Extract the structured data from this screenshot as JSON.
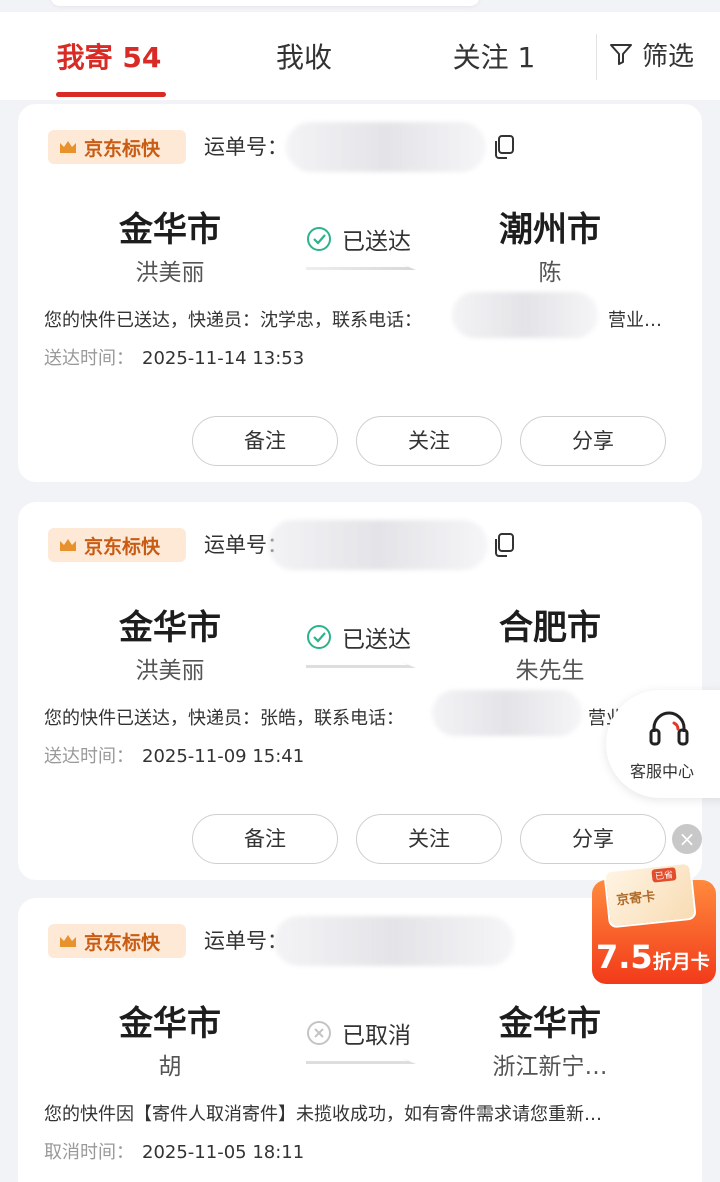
{
  "tabs": [
    {
      "label": "我寄 54",
      "active": true
    },
    {
      "label": "我收",
      "active": false
    },
    {
      "label": "关注 1",
      "active": false
    }
  ],
  "filter_label": "筛选",
  "waybill_label": "运单号：",
  "orders": [
    {
      "brand": "京东标快",
      "from_city": "金华市",
      "from_person": "洪美丽",
      "status": "已送达",
      "status_type": "delivered",
      "to_city": "潮州市",
      "to_person": "陈",
      "description": "您的快件已送达，快递员：沈学忠，联系电话：",
      "description_tail": "营业…",
      "time_label": "送达时间：",
      "time_value": "2025-11-14 13:53",
      "buttons": [
        "备注",
        "关注",
        "分享"
      ]
    },
    {
      "brand": "京东标快",
      "from_city": "金华市",
      "from_person": "洪美丽",
      "status": "已送达",
      "status_type": "delivered",
      "to_city": "合肥市",
      "to_person": "朱先生",
      "description": "您的快件已送达，快递员：张皓，联系电话：",
      "description_tail": "营业",
      "time_label": "送达时间：",
      "time_value": "2025-11-09 15:41",
      "buttons": [
        "备注",
        "关注",
        "分享"
      ]
    },
    {
      "brand": "京东标快",
      "from_city": "金华市",
      "from_person": "胡",
      "status": "已取消",
      "status_type": "cancelled",
      "to_city": "金华市",
      "to_person": "浙江新宁…",
      "description": "您的快件因【寄件人取消寄件】未揽收成功，如有寄件需求请您重新…",
      "description_tail": "",
      "time_label": "取消时间：",
      "time_value": "2025-11-05 18:11",
      "buttons": []
    }
  ],
  "customer_service_label": "客服中心",
  "promo": {
    "card_text": "京寄卡",
    "tag": "已省",
    "discount": "7.5",
    "suffix": "折月卡"
  },
  "colors": {
    "accent": "#d92b25",
    "brand_bg": "#fde9d6",
    "brand_text": "#c85c14",
    "success": "#2bb38a"
  }
}
